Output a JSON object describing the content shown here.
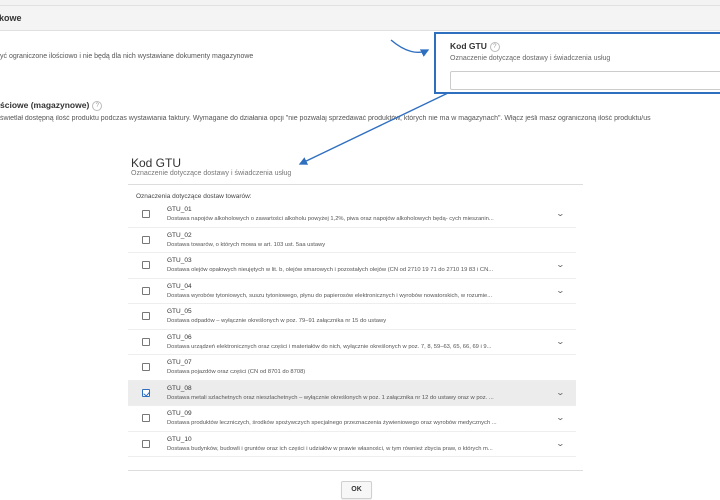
{
  "background": {
    "section_header": "kowe",
    "desc_line1": "yć ograniczone ilościowo i nie będą dla nich wystawiane dokumenty magazynowe",
    "subsection_title": "ściowe (magazynowe)",
    "desc_line2": "świetlał dostępną ilość produktu podczas wystawiania faktury. Wymagane do działania opcji \"nie pozwalaj sprzedawać produktów, których nie ma w magazynach\". Włącz jeśli masz ograniczoną ilość produktu/us"
  },
  "gtu_field": {
    "title": "Kod GTU",
    "help_icon": "?",
    "subtitle": "Oznaczenie dotyczące dostawy i świadczenia usług",
    "value": ""
  },
  "modal": {
    "title": "Kod GTU",
    "subtitle": "Oznaczenie dotyczące dostawy i świadczenia usług",
    "section_label": "Oznaczenia dotyczące dostaw towarów:",
    "items": [
      {
        "code": "GTU_01",
        "desc": "Dostawa napojów alkoholowych o zawartości alkoholu powyżej 1,2%, piwa oraz napojów alkoholowych będą- cych mieszanin...",
        "checked": false
      },
      {
        "code": "GTU_02",
        "desc": "Dostawa towarów, o których mowa w art. 103 ust. 5aa ustawy",
        "checked": false
      },
      {
        "code": "GTU_03",
        "desc": "Dostawa olejów opałowych nieujętych w lit. b, olejów smarowych i pozostałych olejów (CN od 2710 19 71 do 2710 19 83 i CN...",
        "checked": false
      },
      {
        "code": "GTU_04",
        "desc": "Dostawa wyrobów tytoniowych, suszu tytoniowego, płynu do papierosów elektronicznych i wyrobów nowatorskich, w rozumie...",
        "checked": false
      },
      {
        "code": "GTU_05",
        "desc": "Dostawa odpadów – wyłącznie określonych w poz. 79–91 załącznika nr 15 do ustawy",
        "checked": false
      },
      {
        "code": "GTU_06",
        "desc": "Dostawa urządzeń elektronicznych oraz części i materiałów do nich, wyłącznie określonych w poz. 7, 8, 59–63, 65, 66, 69 i 9...",
        "checked": false
      },
      {
        "code": "GTU_07",
        "desc": "Dostawa pojazdów oraz części (CN od 8701 do 8708)",
        "checked": false
      },
      {
        "code": "GTU_08",
        "desc": "Dostawa metali szlachetnych oraz nieszlachetnych – wyłącznie określonych w poz. 1 załącznika nr 12 do ustawy oraz w poz. ...",
        "checked": true
      },
      {
        "code": "GTU_09",
        "desc": "Dostawa produktów leczniczych, środków spożywczych specjalnego przeznaczenia żywieniowego oraz wyrobów medycznych ...",
        "checked": false
      },
      {
        "code": "GTU_10",
        "desc": "Dostawa budynków, budowli i gruntów oraz ich części i udziałów w prawie własności, w tym również zbycia praw, o których m...",
        "checked": false
      }
    ],
    "ok_label": "OK"
  },
  "colors": {
    "accent": "#2f6fc0",
    "selected_row": "#ececec"
  },
  "icons": {
    "help": "question-circle-icon",
    "expand": "chevron-down-icon",
    "pointer": "curved-arrow-icon"
  }
}
